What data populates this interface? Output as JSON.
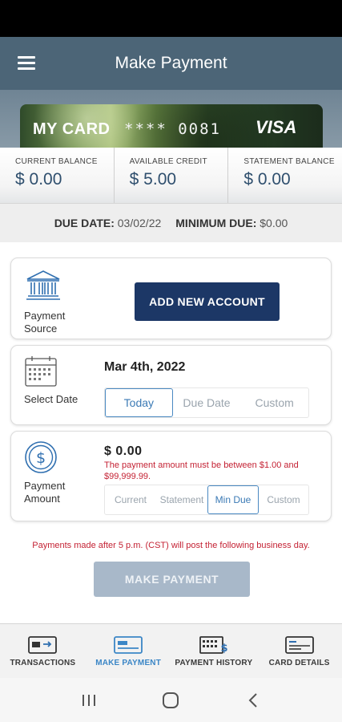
{
  "header": {
    "title": "Make Payment"
  },
  "card": {
    "name": "MY CARD",
    "number": "**** 0081",
    "brand": "VISA"
  },
  "balances": [
    {
      "label": "CURRENT BALANCE",
      "value": "$ 0.00"
    },
    {
      "label": "AVAILABLE CREDIT",
      "value": "$ 5.00"
    },
    {
      "label": "STATEMENT BALANCE",
      "value": "$ 0.00"
    }
  ],
  "due": {
    "due_date_label": "DUE DATE:",
    "due_date_value": "03/02/22",
    "minimum_due_label": "MINIMUM DUE:",
    "minimum_due_value": "$0.00"
  },
  "payment_source": {
    "label_line1": "Payment",
    "label_line2": "Source",
    "button": "ADD NEW ACCOUNT"
  },
  "select_date": {
    "label": "Select Date",
    "value": "Mar 4th, 2022",
    "options": [
      "Today",
      "Due Date",
      "Custom"
    ],
    "selected": "Today"
  },
  "payment_amount": {
    "label_line1": "Payment",
    "label_line2": "Amount",
    "value": "$  0.00",
    "error": "The payment amount must be between $1.00 and $99,999.99.",
    "options": [
      "Current",
      "Statement",
      "Min Due",
      "Custom"
    ],
    "selected": "Min Due"
  },
  "notice": "Payments made after 5 p.m. (CST) will post the following business day.",
  "make_payment_button": "MAKE PAYMENT",
  "tabs": [
    {
      "label": "TRANSACTIONS",
      "icon": "transactions-card-icon",
      "active": false
    },
    {
      "label": "MAKE PAYMENT",
      "icon": "make-payment-card-icon",
      "active": true
    },
    {
      "label": "PAYMENT HISTORY",
      "icon": "payment-history-icon",
      "active": false
    },
    {
      "label": "CARD DETAILS",
      "icon": "card-details-icon",
      "active": false
    }
  ],
  "colors": {
    "header": "#4c6577",
    "primary_button": "#1c3766",
    "disabled_button": "#a8b8c9",
    "accent": "#3b86c6",
    "error": "#c42234"
  }
}
